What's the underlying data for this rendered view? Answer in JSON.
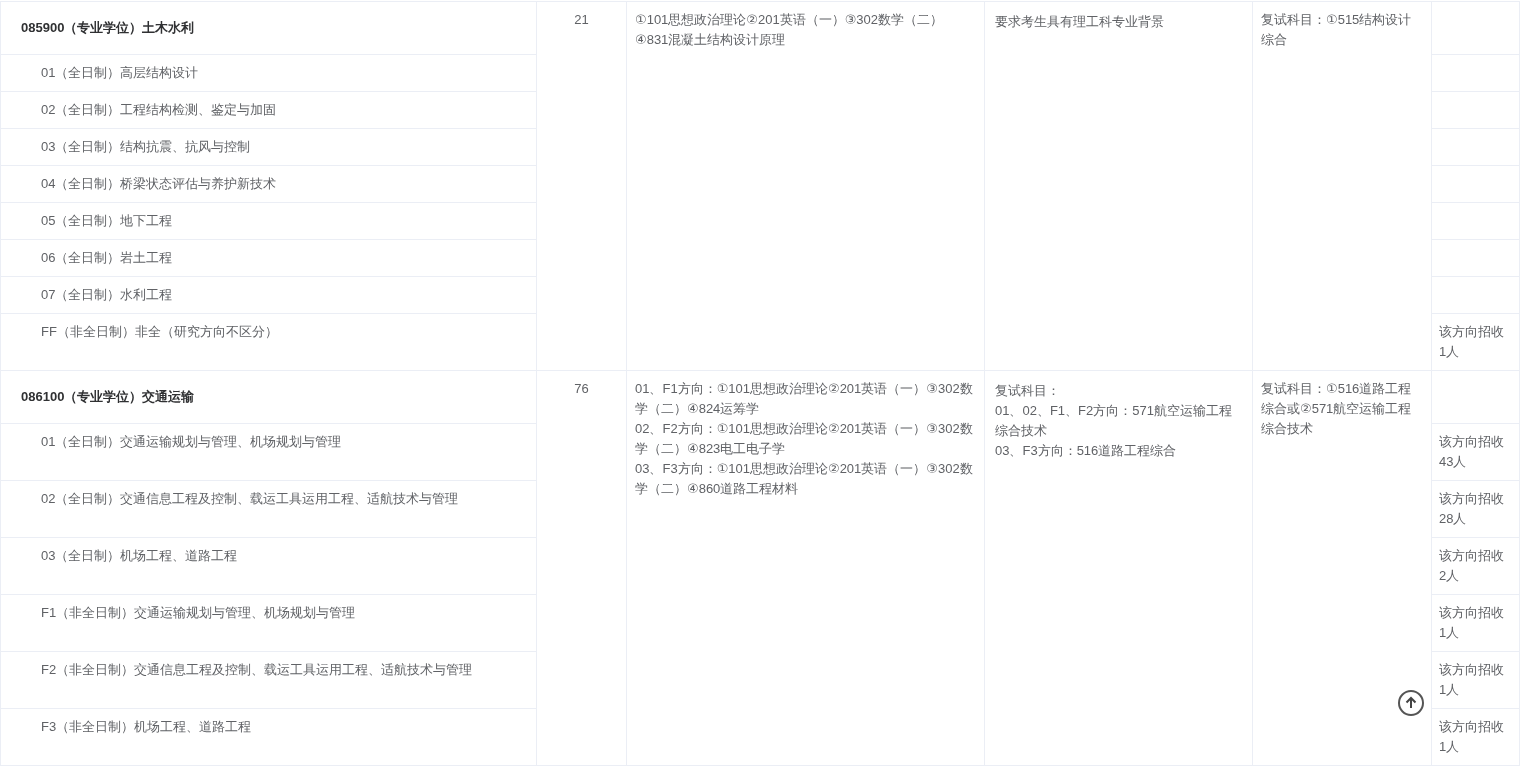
{
  "programs": [
    {
      "title": "085900（专业学位）土木水利",
      "count": "21",
      "exams": [
        "①101思想政治理论②201英语（一）③302数学（二）④831混凝土结构设计原理"
      ],
      "requirement": [
        "要求考生具有理工科专业背景"
      ],
      "retest": [
        "复试科目：①515结构设计综合"
      ],
      "directions": [
        {
          "name": "01（全日制）高层结构设计"
        },
        {
          "name": "02（全日制）工程结构检测、鉴定与加固"
        },
        {
          "name": "03（全日制）结构抗震、抗风与控制"
        },
        {
          "name": "04（全日制）桥梁状态评估与养护新技术"
        },
        {
          "name": "05（全日制）地下工程"
        },
        {
          "name": "06（全日制）岩土工程"
        },
        {
          "name": "07（全日制）水利工程"
        },
        {
          "name": "FF（非全日制）非全（研究方向不区分）",
          "note": "该方向招收1人"
        }
      ]
    },
    {
      "title": "086100（专业学位）交通运输",
      "count": "76",
      "exams": [
        "01、F1方向：①101思想政治理论②201英语（一）③302数学（二）④824运筹学",
        "02、F2方向：①101思想政治理论②201英语（一）③302数学（二）④823电工电子学",
        "03、F3方向：①101思想政治理论②201英语（一）③302数学（二）④860道路工程材料"
      ],
      "requirement": [
        "复试科目：",
        "01、02、F1、F2方向：571航空运输工程综合技术",
        "03、F3方向：516道路工程综合"
      ],
      "retest": [
        "复试科目：①516道路工程综合或②571航空运输工程综合技术"
      ],
      "directions": [
        {
          "name": "01（全日制）交通运输规划与管理、机场规划与管理",
          "note": "该方向招收43人"
        },
        {
          "name": "02（全日制）交通信息工程及控制、载运工具运用工程、适航技术与管理",
          "note": "该方向招收28人"
        },
        {
          "name": "03（全日制）机场工程、道路工程",
          "note": "该方向招收2人"
        },
        {
          "name": "F1（非全日制）交通运输规划与管理、机场规划与管理",
          "note": "该方向招收1人"
        },
        {
          "name": "F2（非全日制）交通信息工程及控制、载运工具运用工程、适航技术与管理",
          "note": "该方向招收1人"
        },
        {
          "name": "F3（非全日制）机场工程、道路工程",
          "note": "该方向招收1人"
        }
      ]
    }
  ]
}
